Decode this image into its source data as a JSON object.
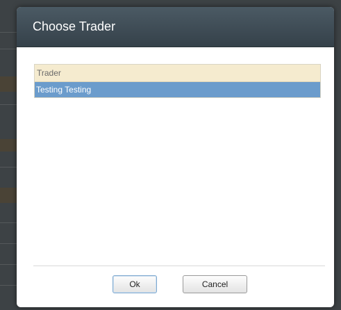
{
  "dialog": {
    "title": "Choose Trader",
    "grid": {
      "columns": [
        "Trader"
      ],
      "rows": [
        {
          "trader": "Testing Testing",
          "selected": true
        }
      ]
    },
    "buttons": {
      "ok_label": "Ok",
      "cancel_label": "Cancel"
    }
  },
  "colors": {
    "header_bg": "#3c4a53",
    "grid_header_bg": "#f5ebcf",
    "selected_row_bg": "#6b9ccc"
  }
}
